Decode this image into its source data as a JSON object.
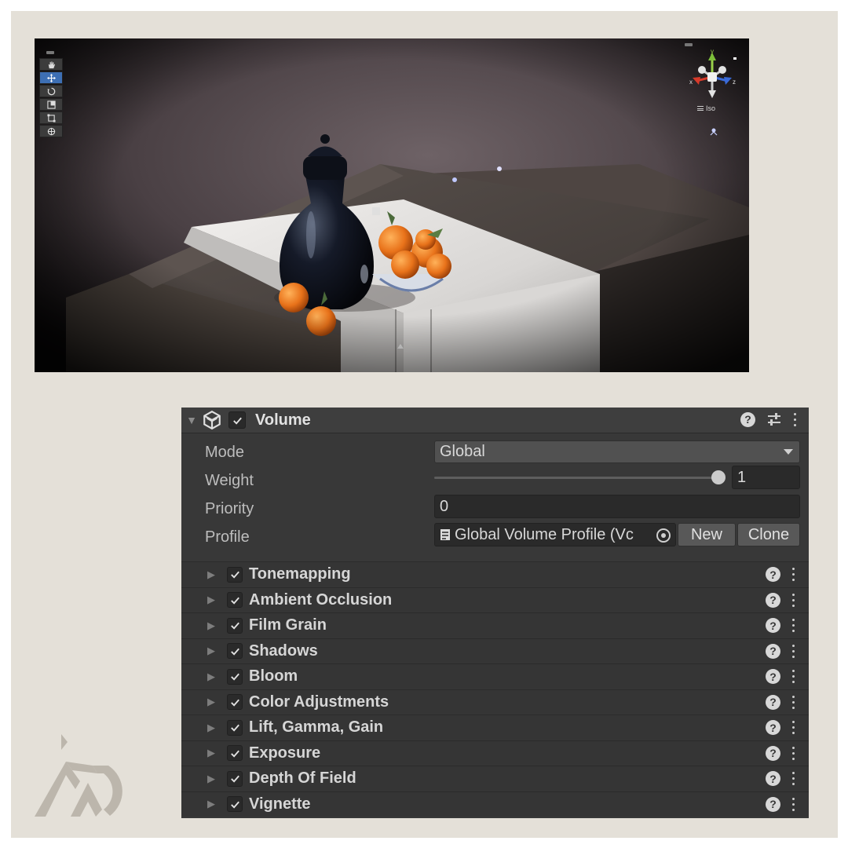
{
  "scene_view": {
    "tools": [
      {
        "name": "hand-tool",
        "icon": "hand-icon",
        "active": false
      },
      {
        "name": "move-tool",
        "icon": "move-icon",
        "active": true
      },
      {
        "name": "rotate-tool",
        "icon": "rotate-icon",
        "active": false
      },
      {
        "name": "scale-tool",
        "icon": "scale-icon",
        "active": false
      },
      {
        "name": "rect-tool",
        "icon": "rect-icon",
        "active": false
      },
      {
        "name": "transform-tool",
        "icon": "transform-icon",
        "active": false
      }
    ],
    "gizmo": {
      "axis_y": "y",
      "axis_x": "x",
      "axis_z": "z",
      "projection": "Iso"
    }
  },
  "volume": {
    "title": "Volume",
    "enabled": true,
    "mode_label": "Mode",
    "mode_value": "Global",
    "weight_label": "Weight",
    "weight_value": "1",
    "weight_fraction": 1.0,
    "priority_label": "Priority",
    "priority_value": "0",
    "profile_label": "Profile",
    "profile_value": "Global Volume Profile (Vc",
    "new_label": "New",
    "clone_label": "Clone",
    "overrides": [
      {
        "label": "Tonemapping",
        "enabled": true
      },
      {
        "label": "Ambient Occlusion",
        "enabled": true
      },
      {
        "label": "Film Grain",
        "enabled": true
      },
      {
        "label": "Shadows",
        "enabled": true
      },
      {
        "label": "Bloom",
        "enabled": true
      },
      {
        "label": "Color Adjustments",
        "enabled": true
      },
      {
        "label": "Lift, Gamma, Gain",
        "enabled": true
      },
      {
        "label": "Exposure",
        "enabled": true
      },
      {
        "label": "Depth Of Field",
        "enabled": true
      },
      {
        "label": "Vignette",
        "enabled": true
      }
    ]
  },
  "colors": {
    "panel_bg": "#383838",
    "header_bg": "#3e3e3e",
    "active_tool": "#3d6fb4",
    "frame_bg": "#e4e0d8",
    "orange": "#e8721a"
  }
}
